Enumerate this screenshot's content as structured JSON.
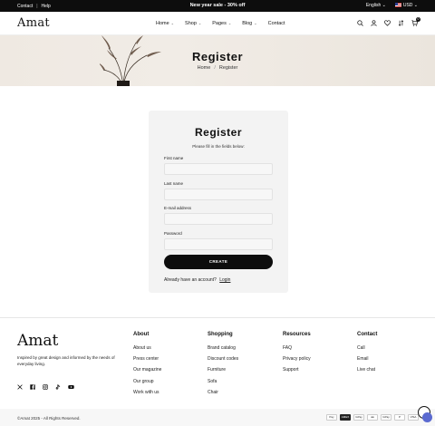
{
  "topbar": {
    "contact": "Contact",
    "help": "Help",
    "promo": "New year sale - 30% off",
    "language": "English",
    "currency": "USD"
  },
  "header": {
    "logo": "Amat",
    "nav": [
      "Home",
      "Shop",
      "Pages",
      "Blog",
      "Contact"
    ],
    "cart_count": "0"
  },
  "hero": {
    "title": "Register",
    "breadcrumb_home": "Home",
    "breadcrumb_current": "Register"
  },
  "form": {
    "title": "Register",
    "subtitle": "Please fill in the fields below:",
    "first_name_label": "First name",
    "last_name_label": "Last name",
    "email_label": "E-mail address",
    "password_label": "Password",
    "create_label": "CREATE",
    "have_account": "Already have an account?",
    "login_link": "Login"
  },
  "footer": {
    "logo": "Amat",
    "tagline": "Inspired by great design and informed by the needs of everyday living.",
    "columns": [
      {
        "title": "About",
        "links": [
          "About us",
          "Press center",
          "Our magazine",
          "Our group",
          "Work with us"
        ]
      },
      {
        "title": "Shopping",
        "links": [
          "Brand catalog",
          "Discount codes",
          "Furniture",
          "Sofa",
          "Chair"
        ]
      },
      {
        "title": "Resources",
        "links": [
          "FAQ",
          "Privacy policy",
          "Support"
        ]
      },
      {
        "title": "Contact",
        "links": [
          "Call",
          "Email",
          "Live chat"
        ]
      }
    ],
    "copyright": "©Amat 2025 - All Rights Reserved.",
    "payments": [
      "Apple Pay",
      "Amex",
      "G Pay",
      "Mastercard",
      "G Pay",
      "PayPal",
      "Visa"
    ]
  }
}
